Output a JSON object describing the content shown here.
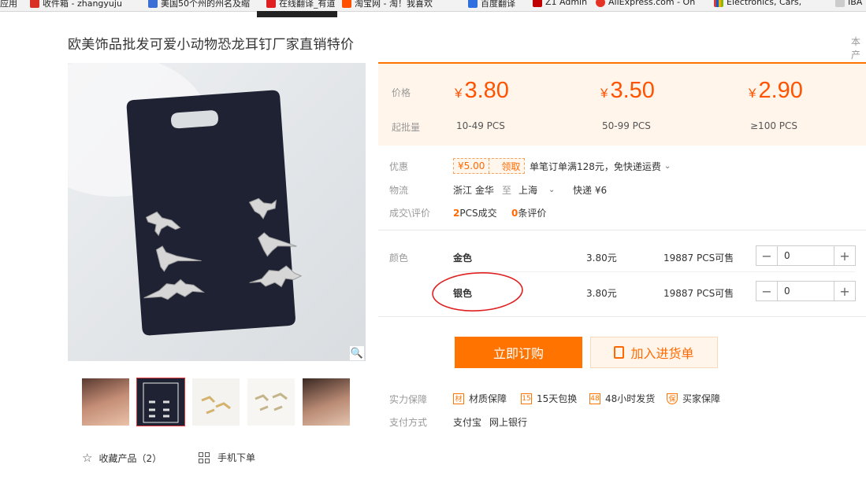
{
  "bookmarks": [
    {
      "label": "应用",
      "icon": "apps-icon",
      "color": "#4a7fe0"
    },
    {
      "label": "收件箱 - zhangyuju",
      "icon": "gmail-icon",
      "color": "#d93025"
    },
    {
      "label": "美国50个州的州名及缩",
      "icon": "page-icon",
      "color": "#3c6fd6"
    },
    {
      "label": "在线翻译_有道",
      "icon": "youdao-icon",
      "color": "#e02020"
    },
    {
      "label": "淘宝网 - 淘！我喜欢",
      "icon": "taobao-icon",
      "color": "#ff5000"
    },
    {
      "label": "百度翻译",
      "icon": "baidu-icon",
      "color": "#2f6fe0"
    },
    {
      "label": "Z1 Admin",
      "icon": "admin-icon",
      "color": "#c00000"
    },
    {
      "label": "AliExpress.com - On",
      "icon": "aliexpress-icon",
      "color": "#e43225"
    },
    {
      "label": "Electronics, Cars,",
      "icon": "ebay-icon",
      "color": "#0064d2"
    },
    {
      "label": "IBA",
      "icon": "iba-icon",
      "color": "#555555"
    }
  ],
  "product": {
    "title": "欧美饰品批发可爱小动物恐龙耳钉厂家直销特价",
    "title_right": "本产"
  },
  "prices": {
    "price_label": "价格",
    "moq_label": "起批量",
    "currency": "¥",
    "tiers": [
      {
        "price": "3.80",
        "qty": "10-49 PCS"
      },
      {
        "price": "3.50",
        "qty": "50-99 PCS"
      },
      {
        "price": "2.90",
        "qty": "≥100 PCS"
      }
    ]
  },
  "promo": {
    "label": "优惠",
    "coupon_value": "¥5.00",
    "coupon_action": "领取",
    "text": "单笔订单满128元，免快递运费"
  },
  "logistics": {
    "label": "物流",
    "from": "浙江 金华",
    "to_word": "至",
    "to": "上海",
    "express": "快递 ¥6"
  },
  "deals": {
    "label": "成交\\评价",
    "count": "2",
    "count_text": "PCS成交",
    "reviews": "0",
    "reviews_text": "条评价"
  },
  "sku": {
    "label": "颜色",
    "rows": [
      {
        "name": "金色",
        "price": "3.80元",
        "stock": "19887 PCS可售",
        "qty": "0"
      },
      {
        "name": "银色",
        "price": "3.80元",
        "stock": "19887 PCS可售",
        "qty": "0"
      }
    ]
  },
  "actions": {
    "buy": "立即订购",
    "cart": "加入进货单"
  },
  "guarantee": {
    "label": "实力保障",
    "items": [
      {
        "icon": "quality-icon",
        "glyph": "材",
        "text": "材质保障"
      },
      {
        "icon": "return-icon",
        "glyph": "15",
        "text": "15天包换"
      },
      {
        "icon": "ship-icon",
        "glyph": "48",
        "text": "48小时发货"
      },
      {
        "icon": "shield-icon",
        "glyph": "保",
        "text": "买家保障"
      }
    ]
  },
  "payment": {
    "label": "支付方式",
    "methods": [
      "支付宝",
      "网上银行"
    ]
  },
  "footer": {
    "favorite": "收藏产品（2）",
    "mobile": "手机下单"
  },
  "colors": {
    "accent": "#ff7300",
    "price": "#ff5300",
    "circle": "#e02020"
  }
}
